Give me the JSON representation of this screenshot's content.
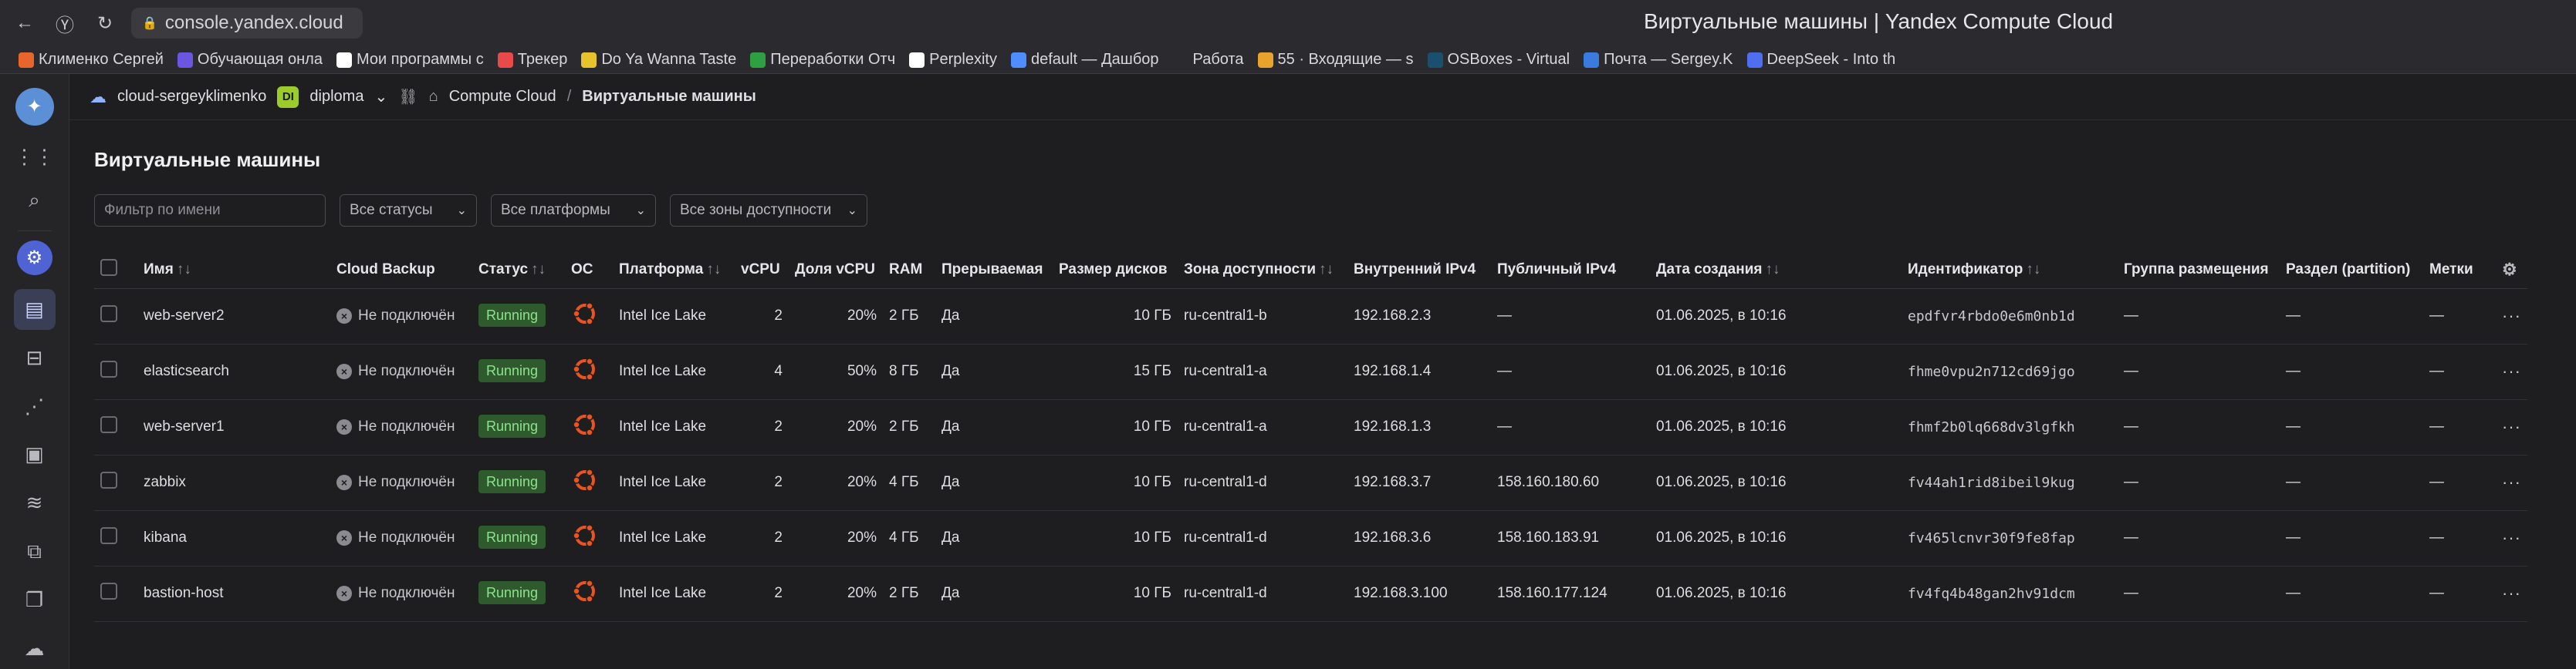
{
  "browser": {
    "url": "console.yandex.cloud",
    "tab_title": "Виртуальные машины | Yandex Compute Cloud",
    "bookmarks": [
      {
        "label": "Клименко Сергей",
        "color": "#e8662c"
      },
      {
        "label": "Обучающая онла",
        "color": "#6a56e0"
      },
      {
        "label": "Мои программы с",
        "color": "#ffffff"
      },
      {
        "label": "Трекер",
        "color": "#e84a4a"
      },
      {
        "label": "Do Ya Wanna Taste",
        "color": "#e8c42c"
      },
      {
        "label": "Переработки Отч",
        "color": "#2ea043"
      },
      {
        "label": "Perplexity",
        "color": "#ffffff"
      },
      {
        "label": "default — Дашбор",
        "color": "#4f8cff"
      },
      {
        "label": "Работа",
        "color": "#2b2b2f"
      },
      {
        "label": "55 · Входящие — s",
        "color": "#e8a32c"
      },
      {
        "label": "OSBoxes - Virtual",
        "color": "#1a4f6e"
      },
      {
        "label": "Почта — Sergey.K",
        "color": "#3a7be0"
      },
      {
        "label": "DeepSeek - Into th",
        "color": "#4f6ef0"
      }
    ]
  },
  "breadcrumb": {
    "cloud": "cloud-sergeyklimenko",
    "folder_badge": "DI",
    "folder": "diploma",
    "service": "Compute Cloud",
    "separator": "/",
    "current": "Виртуальные машины"
  },
  "page": {
    "title": "Виртуальные машины",
    "filter_placeholder": "Фильтр по имени",
    "status_select": "Все статусы",
    "platform_select": "Все платформы",
    "zone_select": "Все зоны доступности"
  },
  "table": {
    "headers": {
      "name": "Имя",
      "backup": "Cloud Backup",
      "status": "Статус",
      "os": "ОС",
      "platform": "Платформа",
      "vcpu": "vCPU",
      "share": "Доля vCPU",
      "ram": "RAM",
      "preempt": "Прерываемая",
      "disk": "Размер дисков",
      "zone": "Зона доступности",
      "ipv4_int": "Внутренний IPv4",
      "ipv4_pub": "Публичный IPv4",
      "created": "Дата создания",
      "id": "Идентификатор",
      "group": "Группа размещения",
      "partition": "Раздел (partition)",
      "labels": "Метки"
    },
    "rows": [
      {
        "name": "web-server2",
        "backup": "Не подключён",
        "status": "Running",
        "platform": "Intel Ice Lake",
        "vcpu": "2",
        "share": "20%",
        "ram": "2 ГБ",
        "preempt": "Да",
        "disk": "10 ГБ",
        "zone": "ru-central1-b",
        "ipv4_int": "192.168.2.3",
        "ipv4_pub": "—",
        "created": "01.06.2025, в 10:16",
        "id": "epdfvr4rbdo0e6m0nb1d",
        "group": "—",
        "partition": "—",
        "labels": "—"
      },
      {
        "name": "elasticsearch",
        "backup": "Не подключён",
        "status": "Running",
        "platform": "Intel Ice Lake",
        "vcpu": "4",
        "share": "50%",
        "ram": "8 ГБ",
        "preempt": "Да",
        "disk": "15 ГБ",
        "zone": "ru-central1-a",
        "ipv4_int": "192.168.1.4",
        "ipv4_pub": "—",
        "created": "01.06.2025, в 10:16",
        "id": "fhme0vpu2n712cd69jgo",
        "group": "—",
        "partition": "—",
        "labels": "—"
      },
      {
        "name": "web-server1",
        "backup": "Не подключён",
        "status": "Running",
        "platform": "Intel Ice Lake",
        "vcpu": "2",
        "share": "20%",
        "ram": "2 ГБ",
        "preempt": "Да",
        "disk": "10 ГБ",
        "zone": "ru-central1-a",
        "ipv4_int": "192.168.1.3",
        "ipv4_pub": "—",
        "created": "01.06.2025, в 10:16",
        "id": "fhmf2b0lq668dv3lgfkh",
        "group": "—",
        "partition": "—",
        "labels": "—"
      },
      {
        "name": "zabbix",
        "backup": "Не подключён",
        "status": "Running",
        "platform": "Intel Ice Lake",
        "vcpu": "2",
        "share": "20%",
        "ram": "4 ГБ",
        "preempt": "Да",
        "disk": "10 ГБ",
        "zone": "ru-central1-d",
        "ipv4_int": "192.168.3.7",
        "ipv4_pub": "158.160.180.60",
        "created": "01.06.2025, в 10:16",
        "id": "fv44ah1rid8ibeil9kug",
        "group": "—",
        "partition": "—",
        "labels": "—"
      },
      {
        "name": "kibana",
        "backup": "Не подключён",
        "status": "Running",
        "platform": "Intel Ice Lake",
        "vcpu": "2",
        "share": "20%",
        "ram": "4 ГБ",
        "preempt": "Да",
        "disk": "10 ГБ",
        "zone": "ru-central1-d",
        "ipv4_int": "192.168.3.6",
        "ipv4_pub": "158.160.183.91",
        "created": "01.06.2025, в 10:16",
        "id": "fv465lcnvr30f9fe8fap",
        "group": "—",
        "partition": "—",
        "labels": "—"
      },
      {
        "name": "bastion-host",
        "backup": "Не подключён",
        "status": "Running",
        "platform": "Intel Ice Lake",
        "vcpu": "2",
        "share": "20%",
        "ram": "2 ГБ",
        "preempt": "Да",
        "disk": "10 ГБ",
        "zone": "ru-central1-d",
        "ipv4_int": "192.168.3.100",
        "ipv4_pub": "158.160.177.124",
        "created": "01.06.2025, в 10:16",
        "id": "fv4fq4b48gan2hv91dcm",
        "group": "—",
        "partition": "—",
        "labels": "—"
      }
    ]
  },
  "colors": {
    "accent": "#4f63d2",
    "running_bg": "#2e5a2e",
    "running_fg": "#8ee28e",
    "ubuntu": "#e95420"
  }
}
